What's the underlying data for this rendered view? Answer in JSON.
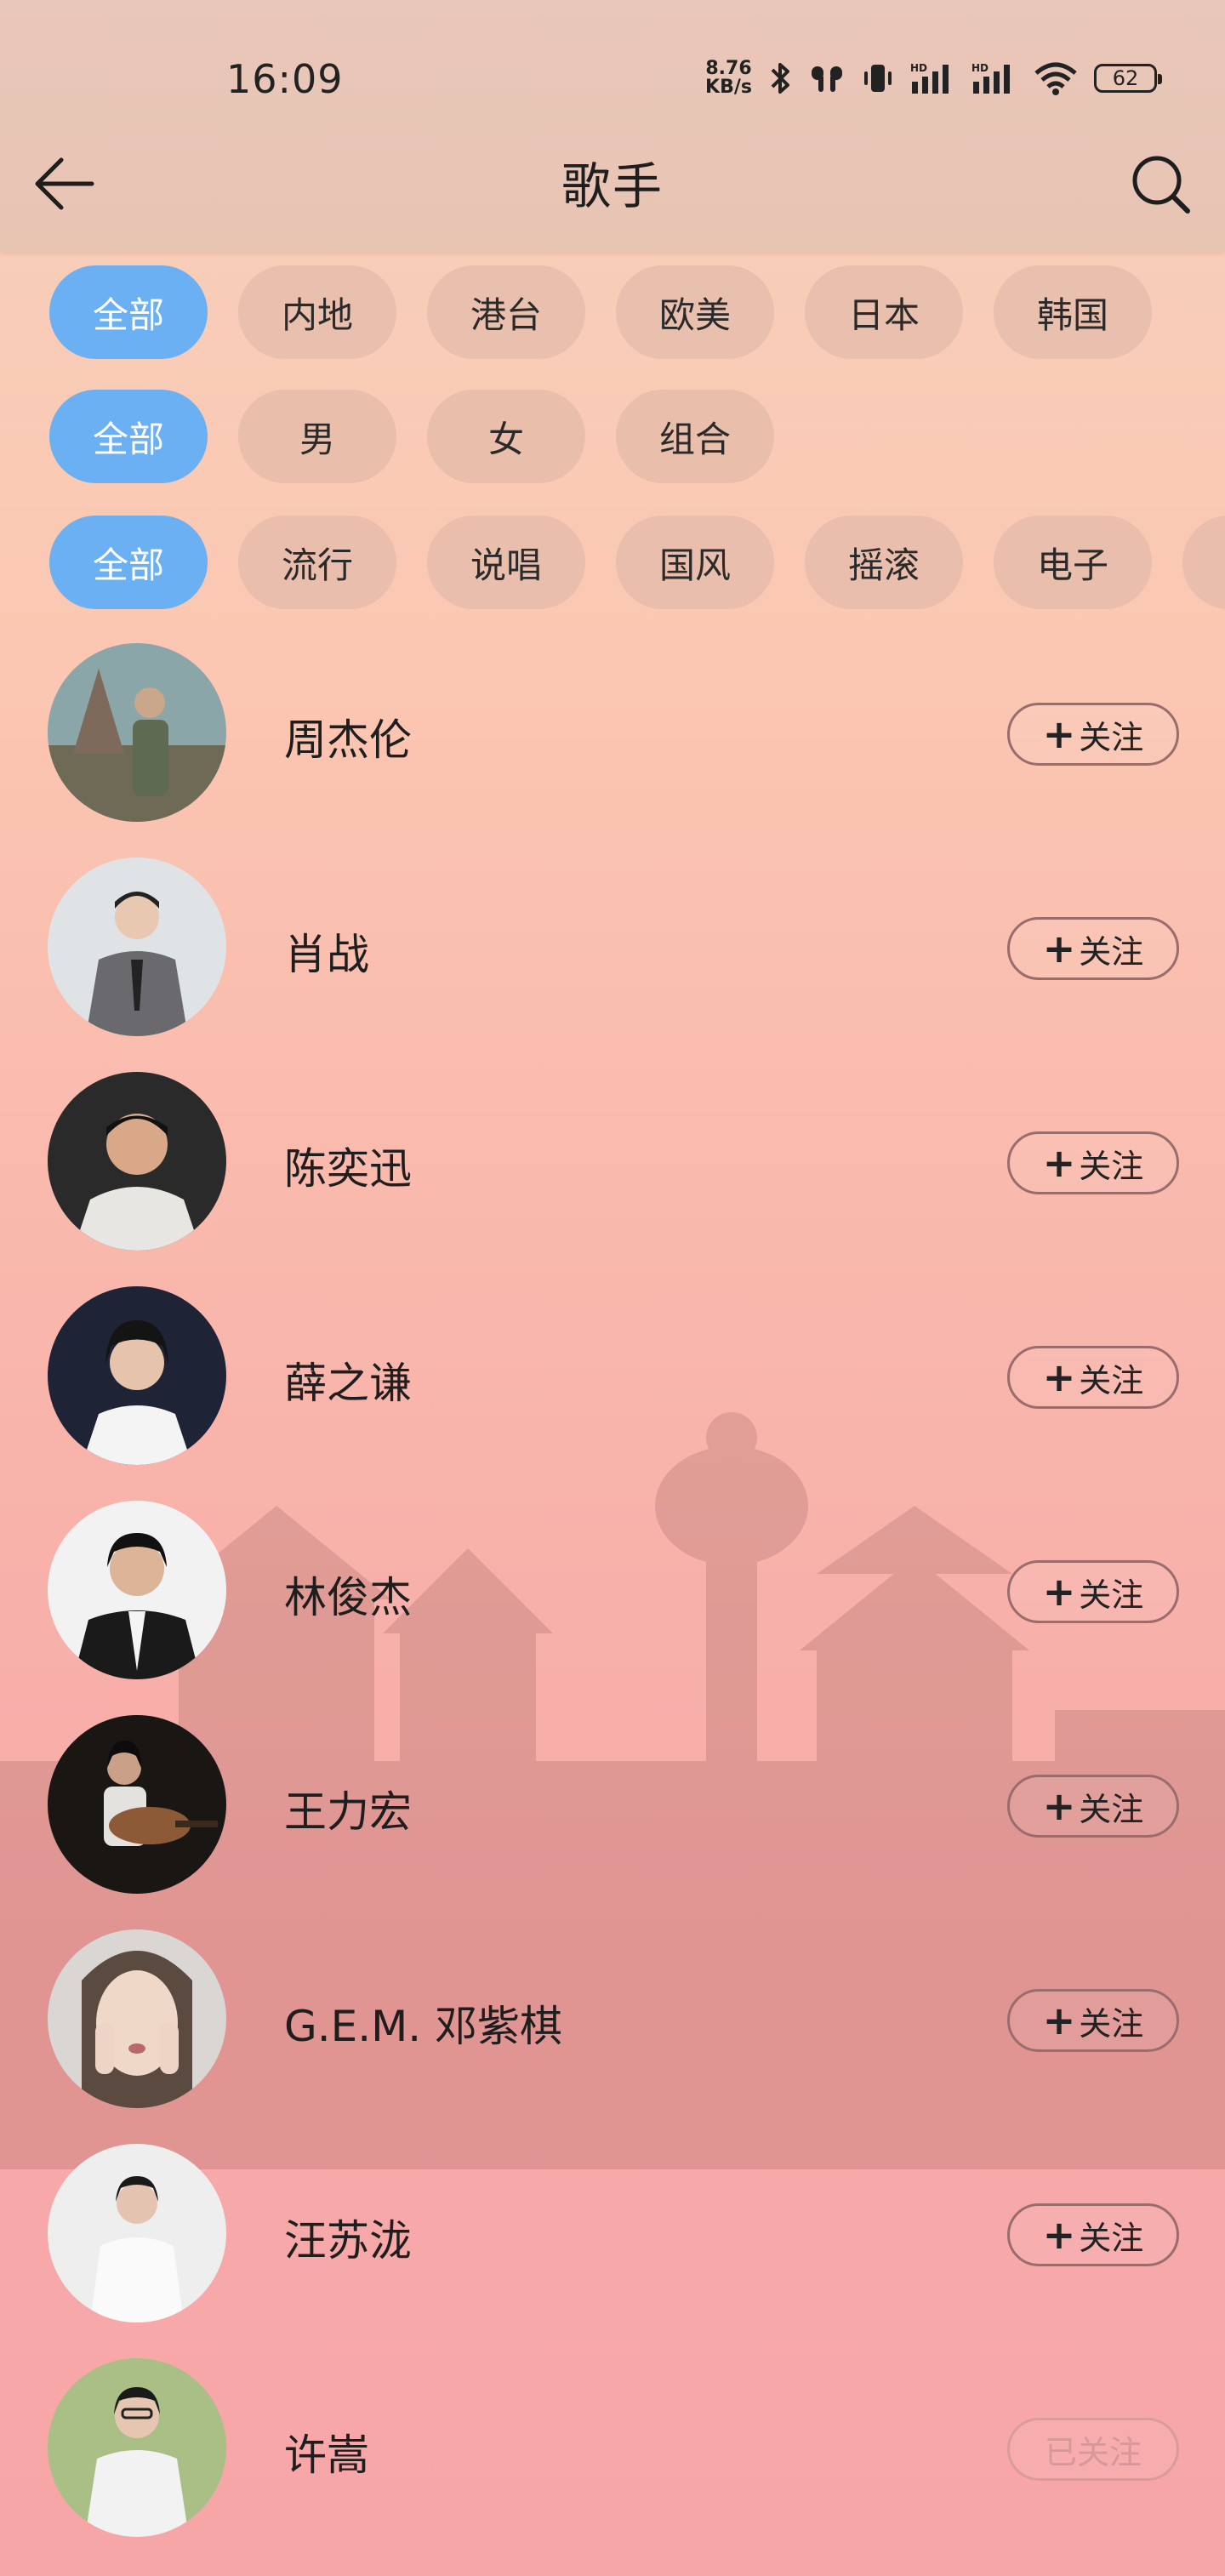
{
  "status_bar": {
    "time": "16:09",
    "net_speed_value": "8.76",
    "net_speed_unit": "KB/s",
    "battery": "62"
  },
  "header": {
    "title": "歌手"
  },
  "filters": {
    "region": [
      "全部",
      "内地",
      "港台",
      "欧美",
      "日本",
      "韩国"
    ],
    "gender": [
      "全部",
      "男",
      "女",
      "组合"
    ],
    "genre": [
      "全部",
      "流行",
      "说唱",
      "国风",
      "摇滚",
      "电子"
    ]
  },
  "singers": [
    {
      "name": "周杰伦",
      "follow_label": "关注"
    },
    {
      "name": "肖战",
      "follow_label": "关注"
    },
    {
      "name": "陈奕迅",
      "follow_label": "关注"
    },
    {
      "name": "薛之谦",
      "follow_label": "关注"
    },
    {
      "name": "林俊杰",
      "follow_label": "关注"
    },
    {
      "name": "王力宏",
      "follow_label": "关注"
    },
    {
      "name": "G.E.M. 邓紫棋",
      "follow_label": "关注"
    },
    {
      "name": "汪苏泷",
      "follow_label": "关注"
    },
    {
      "name": "许嵩",
      "follow_label": "已关注"
    }
  ],
  "colors": {
    "accent": "#6ab0f3",
    "chip": "#e8beac",
    "followed": "#d29696"
  }
}
